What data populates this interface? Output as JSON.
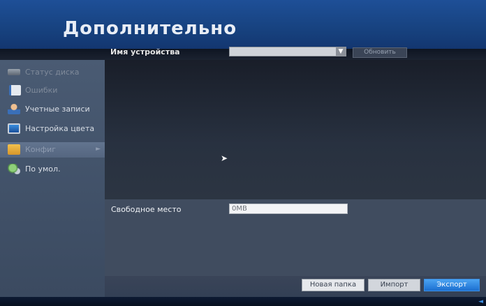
{
  "header": {
    "title": "Дополнительно"
  },
  "top": {
    "device_label": "Имя устройства",
    "device_value": "",
    "refresh_label": "Обновить"
  },
  "sidebar": {
    "items": [
      {
        "label": "Статус диска",
        "icon": "hdd-icon",
        "state": "dim"
      },
      {
        "label": "Ошибки",
        "icon": "error-log-icon",
        "state": "dim"
      },
      {
        "label": "Учетные записи",
        "icon": "user-accounts-icon",
        "state": "normal"
      },
      {
        "label": "Настройка цвета",
        "icon": "monitor-color-icon",
        "state": "normal"
      },
      {
        "label": "Конфиг",
        "icon": "folder-config-icon",
        "state": "active"
      },
      {
        "label": "По умол.",
        "icon": "default-settings-icon",
        "state": "normal"
      }
    ]
  },
  "main": {
    "free_space_label": "Свободное место",
    "free_space_value": "0MB"
  },
  "footer": {
    "new_folder_label": "Новая папка",
    "import_label": "Импорт",
    "export_label": "Экспорт"
  },
  "colors": {
    "accent": "#1e4f97",
    "sidebar": "#4a5b73",
    "export_button": "#2a86e0"
  }
}
